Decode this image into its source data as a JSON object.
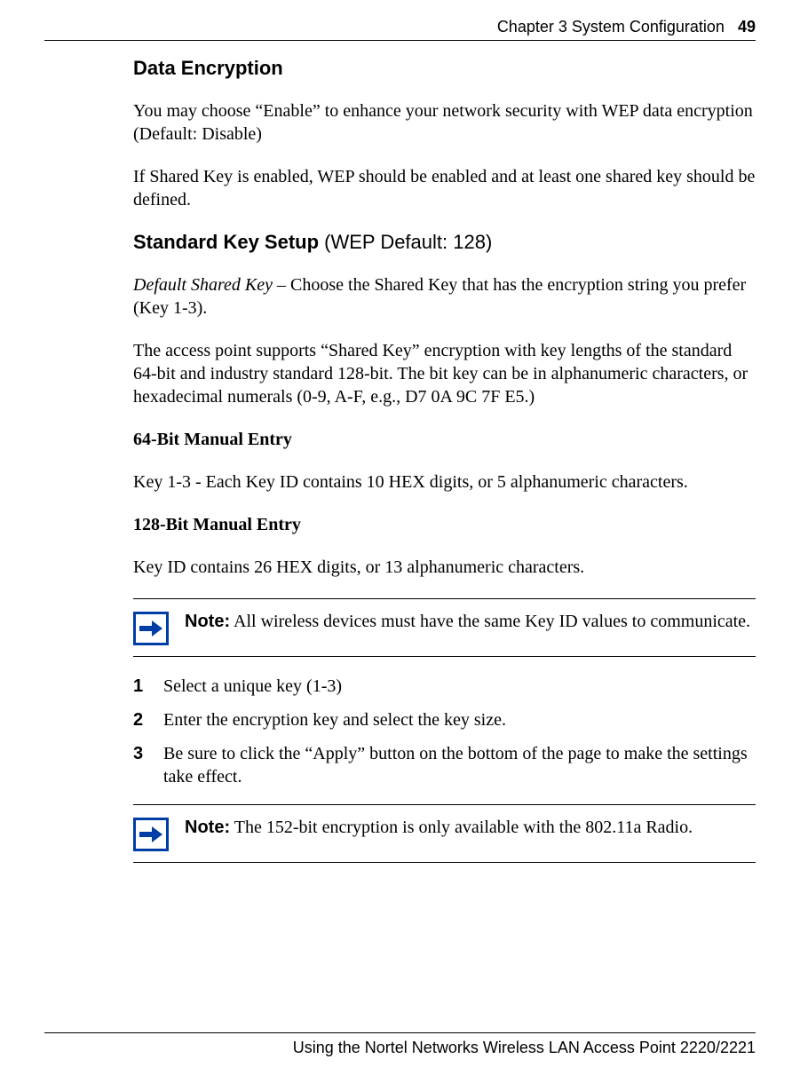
{
  "header": {
    "chapter": "Chapter 3  System Configuration",
    "page": "49"
  },
  "section_data_encryption": {
    "title": "Data Encryption",
    "p1_l1": "You may choose “Enable” to enhance your network security with WEP data encryption",
    "p1_l2": "(Default: Disable)",
    "p2": "If Shared Key is enabled, WEP should be enabled and at least one shared key should be defined."
  },
  "section_standard_key": {
    "title_bold": "Standard Key Setup",
    "title_rest": " (WEP Default: 128)",
    "p1_italic": "Default Shared Key",
    "p1_rest": " – Choose the Shared Key that has the encryption string you prefer (Key 1-3).",
    "p2": "The access point supports “Shared Key” encryption with key lengths of the standard 64-bit and industry standard 128-bit. The bit key can be in alphanumeric characters, or hexadecimal numerals (0-9, A-F, e.g., D7 0A 9C 7F E5.)",
    "h64": "64-Bit Manual Entry",
    "p64": "Key 1-3 - Each Key ID contains 10 HEX digits, or 5 alphanumeric characters.",
    "h128": "128-Bit Manual Entry",
    "p128": "Key ID contains 26 HEX digits, or 13 alphanumeric characters."
  },
  "note1": {
    "label": "Note:",
    "text": " All wireless devices must have the same Key ID values to communicate."
  },
  "steps": [
    "Select a unique key (1-3)",
    "Enter the encryption key and select the key size.",
    "Be sure to click the “Apply” button on the bottom of the page to make the settings take effect."
  ],
  "step_nums": [
    "1",
    "2",
    "3"
  ],
  "note2": {
    "label": "Note:",
    "text": " The 152-bit encryption is only available with the 802.11a Radio."
  },
  "footer": "Using the Nortel Networks Wireless LAN Access Point 2220/2221"
}
